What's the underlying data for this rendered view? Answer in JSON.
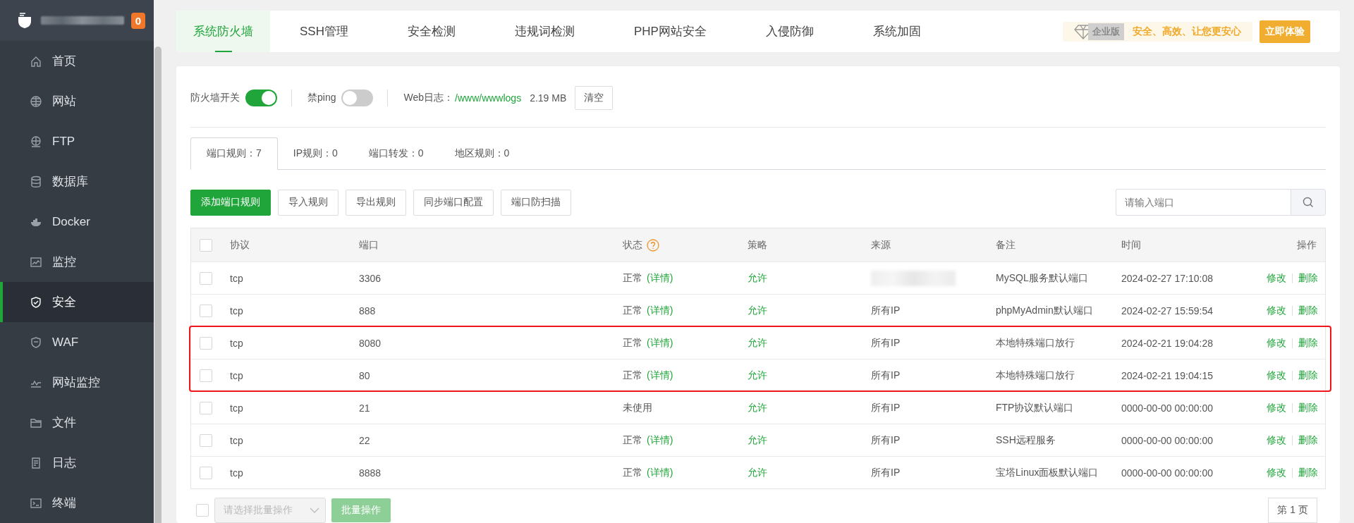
{
  "sidebar": {
    "badge": "0",
    "items": [
      {
        "label": "首页",
        "selected": false
      },
      {
        "label": "网站",
        "selected": false
      },
      {
        "label": "FTP",
        "selected": false
      },
      {
        "label": "数据库",
        "selected": false
      },
      {
        "label": "Docker",
        "selected": false
      },
      {
        "label": "监控",
        "selected": false
      },
      {
        "label": "安全",
        "selected": true
      },
      {
        "label": "WAF",
        "selected": false
      },
      {
        "label": "网站监控",
        "selected": false
      },
      {
        "label": "文件",
        "selected": false
      },
      {
        "label": "日志",
        "selected": false
      },
      {
        "label": "终端",
        "selected": false
      }
    ]
  },
  "top_tabs": [
    {
      "label": "系统防火墙",
      "selected": true
    },
    {
      "label": "SSH管理",
      "selected": false
    },
    {
      "label": "安全检测",
      "selected": false
    },
    {
      "label": "违规词检测",
      "selected": false
    },
    {
      "label": "PHP网站安全",
      "selected": false
    },
    {
      "label": "入侵防御",
      "selected": false
    },
    {
      "label": "系统加固",
      "selected": false
    }
  ],
  "promo": {
    "edition": "企业版",
    "slogan": "安全、高效、让您更安心",
    "button": "立即体验"
  },
  "settings": {
    "firewall": {
      "label": "防火墙开关",
      "on": true
    },
    "ping": {
      "label": "禁ping",
      "on": false
    },
    "web_log": {
      "label": "Web日志：",
      "path": "/www/wwwlogs",
      "size": "2.19 MB",
      "button": "清空"
    }
  },
  "rule_tabs": [
    {
      "label": "端口规则：7",
      "selected": true
    },
    {
      "label": "IP规则：0",
      "selected": false
    },
    {
      "label": "端口转发：0",
      "selected": false
    },
    {
      "label": "地区规则：0",
      "selected": false
    }
  ],
  "actions": [
    {
      "label": "添加端口规则",
      "kind": "primary"
    },
    {
      "label": "导入规则",
      "kind": "default"
    },
    {
      "label": "导出规则",
      "kind": "default"
    },
    {
      "label": "同步端口配置",
      "kind": "default"
    },
    {
      "label": "端口防扫描",
      "kind": "default"
    }
  ],
  "search": {
    "placeholder": "请输入端口"
  },
  "table": {
    "select_all_checked": false,
    "columns": [
      "协议",
      "端口",
      "状态",
      "策略",
      "来源",
      "备注",
      "时间",
      "操作"
    ],
    "rows": [
      {
        "checked": false,
        "highlighted": false,
        "protocol": "tcp",
        "port": "3306",
        "status": "正常",
        "detail": "(详情)",
        "policy": "允许",
        "note": "MySQL服务默认端口",
        "time": "2024-02-27 17:10:08",
        "edit": "修改",
        "delete": "删除"
      },
      {
        "checked": false,
        "highlighted": false,
        "protocol": "tcp",
        "port": "888",
        "status": "正常",
        "detail": "(详情)",
        "policy": "允许",
        "source": "所有IP",
        "note": "phpMyAdmin默认端口",
        "time": "2024-02-27 15:59:54",
        "edit": "修改",
        "delete": "删除"
      },
      {
        "checked": false,
        "highlighted": true,
        "protocol": "tcp",
        "port": "8080",
        "status": "正常",
        "detail": "(详情)",
        "policy": "允许",
        "source": "所有IP",
        "note": "本地特殊端口放行",
        "time": "2024-02-21 19:04:28",
        "edit": "修改",
        "delete": "删除"
      },
      {
        "checked": false,
        "highlighted": true,
        "protocol": "tcp",
        "port": "80",
        "status": "正常",
        "detail": "(详情)",
        "policy": "允许",
        "source": "所有IP",
        "note": "本地特殊端口放行",
        "time": "2024-02-21 19:04:15",
        "edit": "修改",
        "delete": "删除"
      },
      {
        "checked": false,
        "highlighted": false,
        "protocol": "tcp",
        "port": "21",
        "status": "未使用",
        "policy": "允许",
        "source": "所有IP",
        "note": "FTP协议默认端口",
        "time": "0000-00-00 00:00:00",
        "edit": "修改",
        "delete": "删除"
      },
      {
        "checked": false,
        "highlighted": false,
        "protocol": "tcp",
        "port": "22",
        "status": "正常",
        "detail": "(详情)",
        "policy": "允许",
        "source": "所有IP",
        "note": "SSH远程服务",
        "time": "0000-00-00 00:00:00",
        "edit": "修改",
        "delete": "删除"
      },
      {
        "checked": false,
        "highlighted": false,
        "protocol": "tcp",
        "port": "8888",
        "status": "正常",
        "detail": "(详情)",
        "policy": "允许",
        "source": "所有IP",
        "note": "宝塔Linux面板默认端口",
        "time": "0000-00-00 00:00:00",
        "edit": "修改",
        "delete": "删除"
      }
    ]
  },
  "footer": {
    "checked": false,
    "batch_placeholder": "请选择批量操作",
    "batch_button": "批量操作",
    "page": "第 1 页"
  }
}
